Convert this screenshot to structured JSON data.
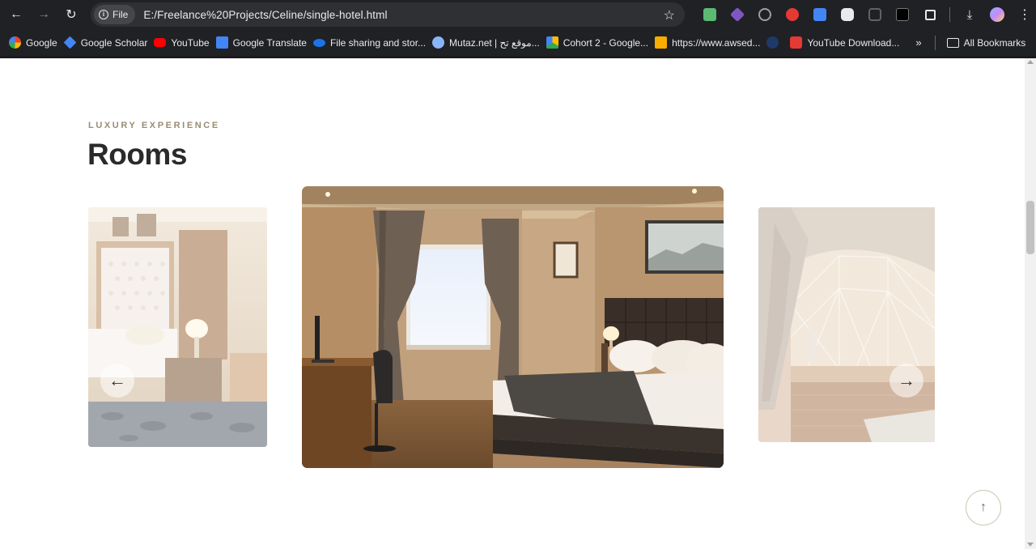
{
  "browser": {
    "site_chip": "File",
    "url": "E:/Freelance%20Projects/Celine/single-hotel.html",
    "bookmarks": [
      {
        "label": "Google",
        "color": "#ea4335"
      },
      {
        "label": "Google Scholar",
        "color": "#4285f4"
      },
      {
        "label": "YouTube",
        "color": "#ff0000"
      },
      {
        "label": "Google Translate",
        "color": "#4285f4"
      },
      {
        "label": "File sharing and stor...",
        "color": "#1a73e8"
      },
      {
        "label": "Mutaz.net | موقع تح...",
        "color": "#8ab4f8"
      },
      {
        "label": "Cohort 2 - Google...",
        "color": "#fbbc04"
      },
      {
        "label": "https://www.awsed...",
        "color": "#f9ab00"
      },
      {
        "label": "",
        "color": "#1f3a68"
      },
      {
        "label": "YouTube Download...",
        "color": "#e53935"
      }
    ],
    "all_bookmarks": "All Bookmarks",
    "extensions": [
      "#5bb974",
      "#7e57c2",
      "#9aa0a6",
      "#e53935",
      "#4285f4",
      "#e8eaed",
      "#9aa0a6",
      "#000000"
    ]
  },
  "section": {
    "eyebrow": "LUXURY EXPERIENCE",
    "title": "Rooms"
  },
  "carousel": {
    "prev_icon": "arrow-left-icon",
    "next_icon": "arrow-right-icon",
    "slides": [
      "room-photo-left",
      "room-photo-center",
      "dome-photo-right"
    ]
  },
  "back_to_top_icon": "arrow-up-icon"
}
